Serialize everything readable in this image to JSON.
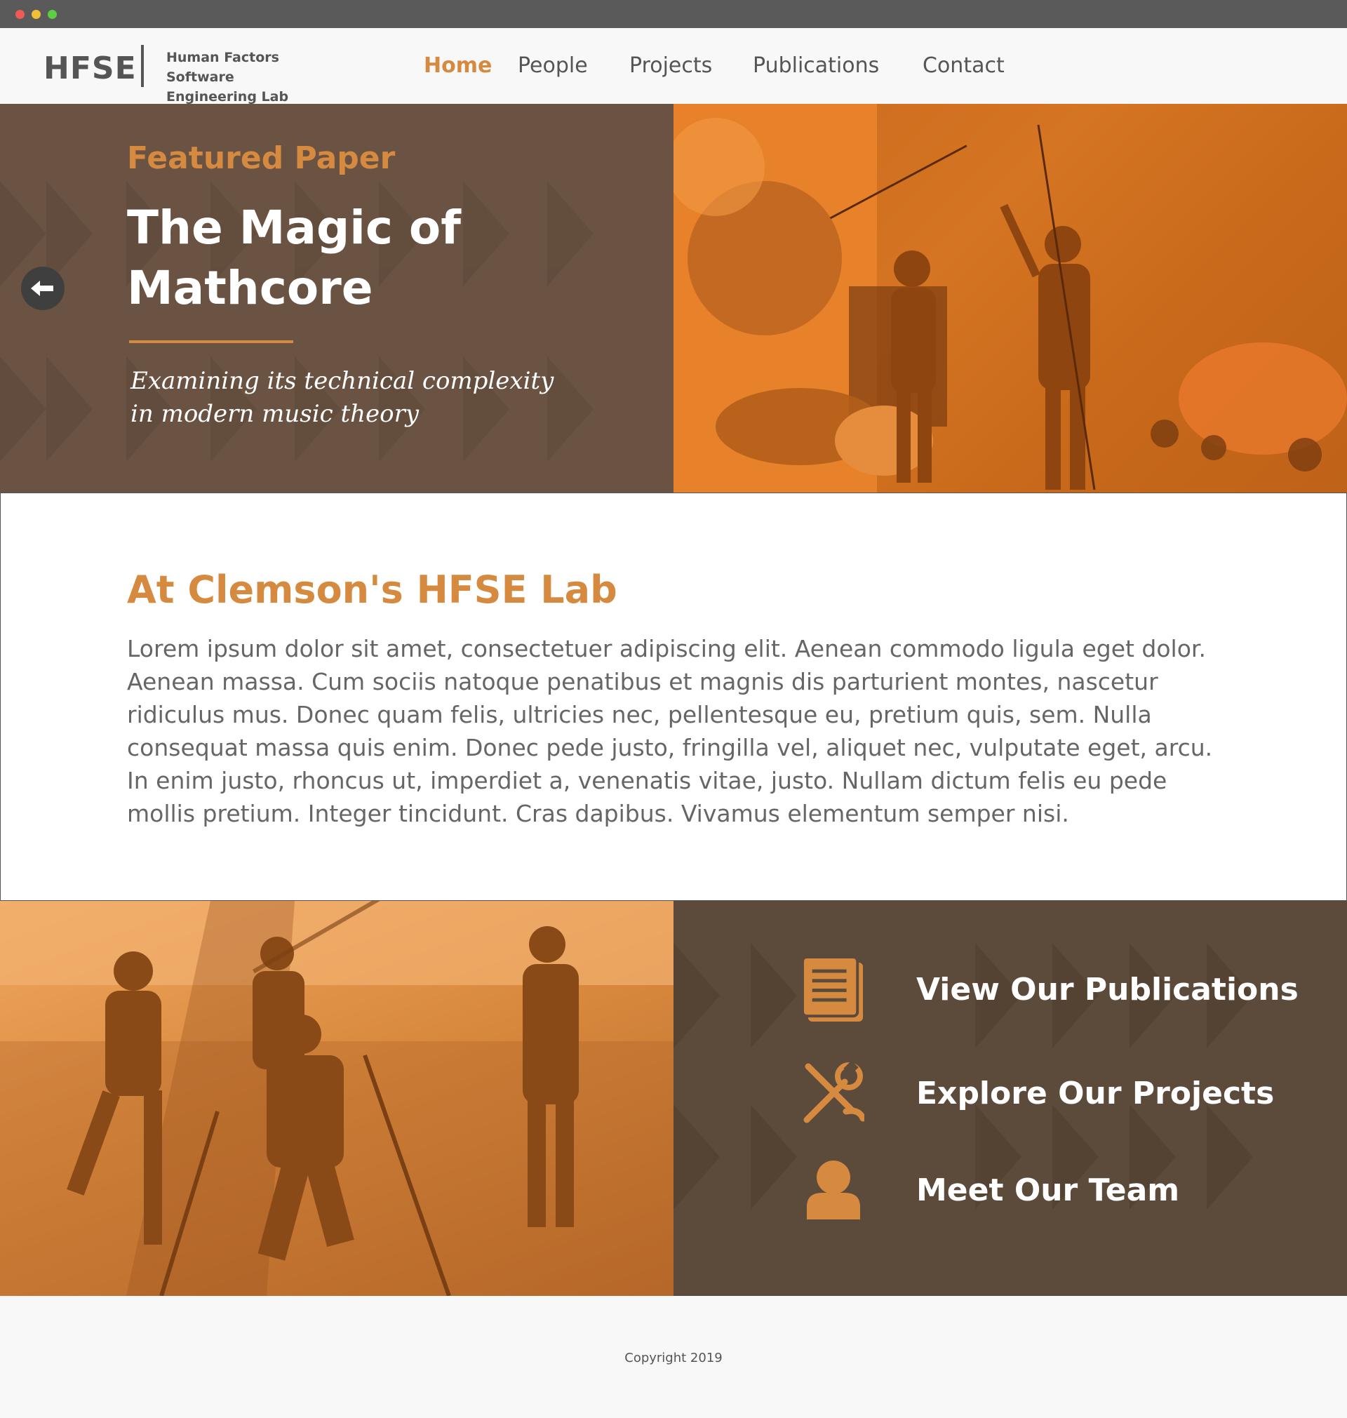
{
  "header": {
    "logo": "HFSE",
    "logo_subtitle_line1": "Human Factors Software",
    "logo_subtitle_line2": "Engineering Lab",
    "nav": [
      {
        "label": "Home",
        "active": true
      },
      {
        "label": "People",
        "active": false
      },
      {
        "label": "Projects",
        "active": false
      },
      {
        "label": "Publications",
        "active": false
      },
      {
        "label": "Contact",
        "active": false
      }
    ]
  },
  "hero": {
    "eyebrow": "Featured Paper",
    "title": "The Magic of Mathcore",
    "subtitle": "Examining its technical complexity in modern music theory",
    "prev_icon": "arrow-left-icon"
  },
  "about": {
    "title": "At Clemson's HFSE Lab",
    "body": "Lorem ipsum dolor sit amet, consectetuer adipiscing elit. Aenean commodo ligula eget dolor. Aenean massa. Cum sociis natoque penatibus et magnis dis parturient montes, nascetur ridiculus mus. Donec quam felis, ultricies nec, pellentesque eu, pretium quis, sem. Nulla consequat massa quis enim. Donec pede justo, fringilla vel, aliquet nec, vulputate eget, arcu. In enim justo, rhoncus ut, imperdiet a, venenatis vitae, justo. Nullam dictum felis eu pede mollis pretium. Integer tincidunt. Cras dapibus. Vivamus elementum semper nisi."
  },
  "links": [
    {
      "label": "View Our Publications",
      "icon": "document-icon"
    },
    {
      "label": "Explore Our Projects",
      "icon": "tools-icon"
    },
    {
      "label": "Meet Our Team",
      "icon": "user-icon"
    }
  ],
  "footer": {
    "copyright": "Copyright 2019"
  },
  "colors": {
    "accent": "#d58a3f",
    "dark_brown": "#6a5342",
    "panel_brown": "#5c4a3b",
    "text_gray": "#555555",
    "orange_photo": "#e0812a"
  }
}
